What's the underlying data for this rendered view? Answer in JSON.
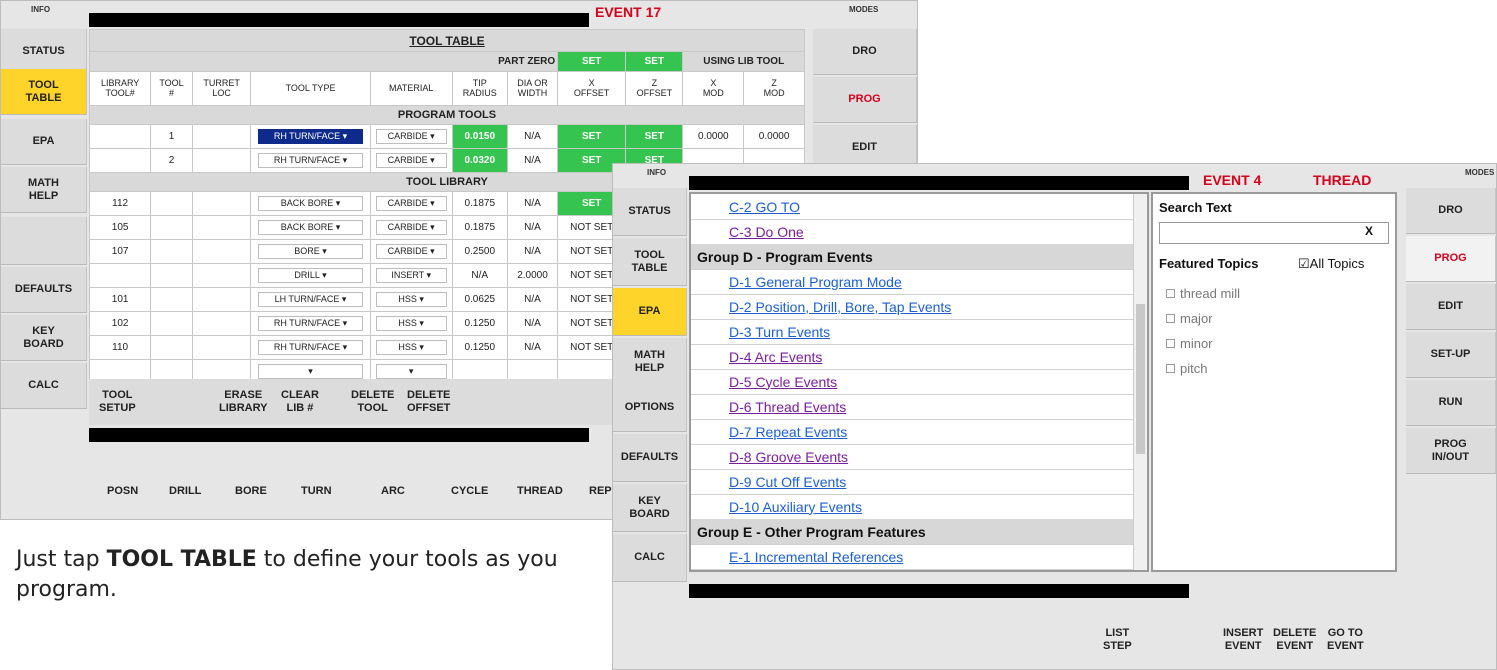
{
  "screen1": {
    "info": "INFO",
    "modes": "MODES",
    "event": "EVENT 17",
    "left_menu": [
      "STATUS",
      "TOOL\nTABLE",
      "EPA",
      "MATH\nHELP",
      "",
      "DEFAULTS",
      "KEY\nBOARD",
      "CALC"
    ],
    "right_menu": [
      "DRO",
      "PROG",
      "EDIT"
    ],
    "title": "TOOL TABLE",
    "part_zero": "PART ZERO",
    "set1": "SET",
    "set2": "SET",
    "using_lib": "USING LIB TOOL",
    "headers": [
      "LIBRARY\nTOOL#",
      "TOOL\n#",
      "TURRET\nLOC",
      "TOOL TYPE",
      "MATERIAL",
      "TIP\nRADIUS",
      "DIA OR\nWIDTH",
      "X\nOFFSET",
      "Z\nOFFSET",
      "X\nMOD",
      "Z\nMOD"
    ],
    "program_tools": "PROGRAM TOOLS",
    "tool_library": "TOOL LIBRARY",
    "program_rows": [
      [
        "",
        "1",
        "",
        "RH TURN/FACE ▾",
        "CARBIDE ▾",
        "0.0150",
        "N/A",
        "SET",
        "SET",
        "0.0000",
        "0.0000"
      ],
      [
        "",
        "2",
        "",
        "RH TURN/FACE ▾",
        "CARBIDE ▾",
        "0.0320",
        "N/A",
        "SET",
        "SET",
        "",
        ""
      ]
    ],
    "library_rows": [
      [
        "112",
        "",
        "",
        "BACK BORE ▾",
        "CARBIDE ▾",
        "0.1875",
        "N/A",
        "SET",
        "",
        "",
        ""
      ],
      [
        "105",
        "",
        "",
        "BACK BORE ▾",
        "CARBIDE ▾",
        "0.1875",
        "N/A",
        "NOT SET",
        "",
        "",
        ""
      ],
      [
        "107",
        "",
        "",
        "BORE ▾",
        "CARBIDE ▾",
        "0.2500",
        "N/A",
        "NOT SET",
        "",
        "",
        ""
      ],
      [
        "",
        "",
        "",
        "DRILL ▾",
        "INSERT ▾",
        "N/A",
        "2.0000",
        "NOT SET",
        "",
        "",
        ""
      ],
      [
        "101",
        "",
        "",
        "LH TURN/FACE ▾",
        "HSS ▾",
        "0.0625",
        "N/A",
        "NOT SET",
        "",
        "",
        ""
      ],
      [
        "102",
        "",
        "",
        "RH TURN/FACE ▾",
        "HSS ▾",
        "0.1250",
        "N/A",
        "NOT SET",
        "",
        "",
        ""
      ],
      [
        "110",
        "",
        "",
        "RH TURN/FACE ▾",
        "HSS ▾",
        "0.1250",
        "N/A",
        "NOT SET",
        "",
        "",
        ""
      ],
      [
        "",
        "",
        "",
        "▾",
        "▾",
        "",
        "",
        "",
        "",
        "",
        ""
      ]
    ],
    "actions": [
      "TOOL\nSETUP",
      "ERASE\nLIBRARY",
      "CLEAR\nLIB #",
      "DELETE\nTOOL",
      "DELETE\nOFFSET"
    ],
    "bottom": [
      "POSN",
      "DRILL",
      "BORE",
      "TURN",
      "ARC",
      "CYCLE",
      "THREAD",
      "REPEA"
    ]
  },
  "screen2": {
    "info": "INFO",
    "modes": "MODES",
    "event": "EVENT 4",
    "thread": "THREAD",
    "left_menu": [
      "STATUS",
      "TOOL\nTABLE",
      "EPA",
      "MATH\nHELP",
      "OPTIONS",
      "DEFAULTS",
      "KEY\nBOARD",
      "CALC"
    ],
    "right_menu": [
      "DRO",
      "PROG",
      "EDIT",
      "SET-UP",
      "RUN",
      "PROG\nIN/OUT"
    ],
    "epa_items": [
      {
        "text": "C-2 GO TO",
        "kind": "blue-link"
      },
      {
        "text": "C-3 Do One",
        "kind": "purple"
      },
      {
        "text": "Group D - Program Events",
        "kind": "group"
      },
      {
        "text": "D-1 General Program Mode",
        "kind": "blue-link"
      },
      {
        "text": "D-2 Position, Drill, Bore, Tap Events",
        "kind": "blue-link"
      },
      {
        "text": "D-3 Turn Events",
        "kind": "blue-link"
      },
      {
        "text": "D-4 Arc Events",
        "kind": "purple"
      },
      {
        "text": "D-5 Cycle Events",
        "kind": "purple"
      },
      {
        "text": "D-6 Thread Events",
        "kind": "purple"
      },
      {
        "text": "D-7 Repeat Events",
        "kind": "blue-link"
      },
      {
        "text": "D-8 Groove Events",
        "kind": "purple"
      },
      {
        "text": "D-9 Cut Off Events",
        "kind": "blue-link"
      },
      {
        "text": "D-10 Auxiliary Events",
        "kind": "blue-link"
      },
      {
        "text": "Group E - Other Program Features",
        "kind": "group"
      },
      {
        "text": "E-1 Incremental References",
        "kind": "blue-link"
      }
    ],
    "search_label": "Search Text",
    "search_clear": "X",
    "featured": "Featured Topics",
    "all_topics": "☑All Topics",
    "topics": [
      "thread mill",
      "major",
      "minor",
      "pitch"
    ],
    "bottom": [
      "LIST\nSTEP",
      "INSERT\nEVENT",
      "DELETE\nEVENT",
      "GO TO\nEVENT"
    ]
  },
  "caption": {
    "pre": "Just tap ",
    "bold": "TOOL TABLE",
    "post": " to define your tools as you program."
  }
}
